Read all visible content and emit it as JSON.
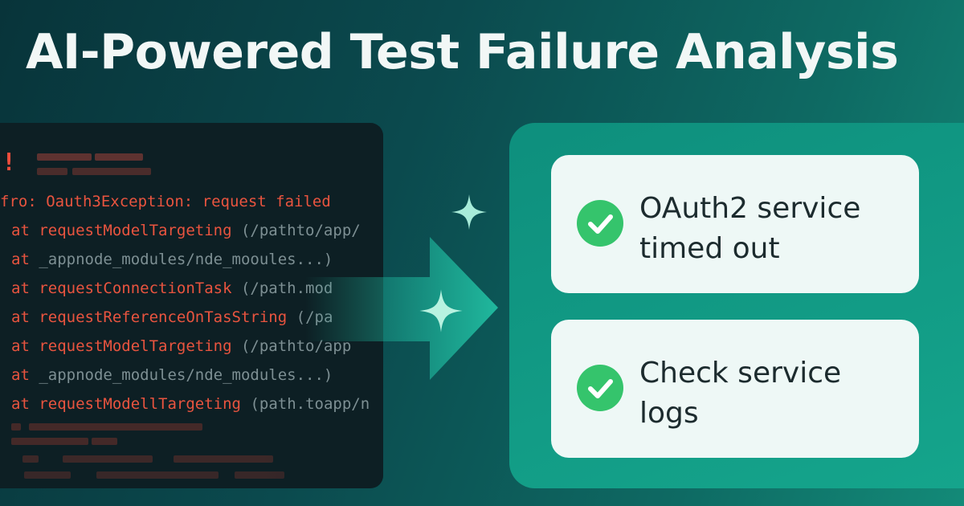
{
  "title": "AI-Powered Test Failure Analysis",
  "terminal": {
    "marker": "!",
    "error_line": "fro: Oauth3Exception: request failed",
    "stack": [
      {
        "prefix": "at ",
        "fn": "requestModelTargeting",
        "path": " (/pathto/app/"
      },
      {
        "prefix": "at ",
        "fn": "",
        "path": "_appnode_modules/nde_mooules...)"
      },
      {
        "prefix": "at ",
        "fn": "requestConnectionTask",
        "path": " (/path.mod"
      },
      {
        "prefix": "at ",
        "fn": "requestReferenceOnTasString",
        "path": " (/pa"
      },
      {
        "prefix": "at ",
        "fn": "requestModelTargeting",
        "path": " (/pathto/app"
      },
      {
        "prefix": "at ",
        "fn": "",
        "path": "_appnode_modules/nde_modules...)"
      },
      {
        "prefix": "at ",
        "fn": "requestModellTargeting",
        "path": " (path.toapp/n"
      }
    ]
  },
  "results": [
    {
      "line1": "OAuth2 service",
      "line2": "timed out",
      "icon": "check-circle-icon"
    },
    {
      "line1": "Check service",
      "line2": "logs",
      "icon": "check-circle-icon"
    }
  ],
  "colors": {
    "error_red": "#e9543f",
    "path_gray": "#7d8f93",
    "accent_green": "#35c46c",
    "panel_teal": "#15a58c"
  }
}
